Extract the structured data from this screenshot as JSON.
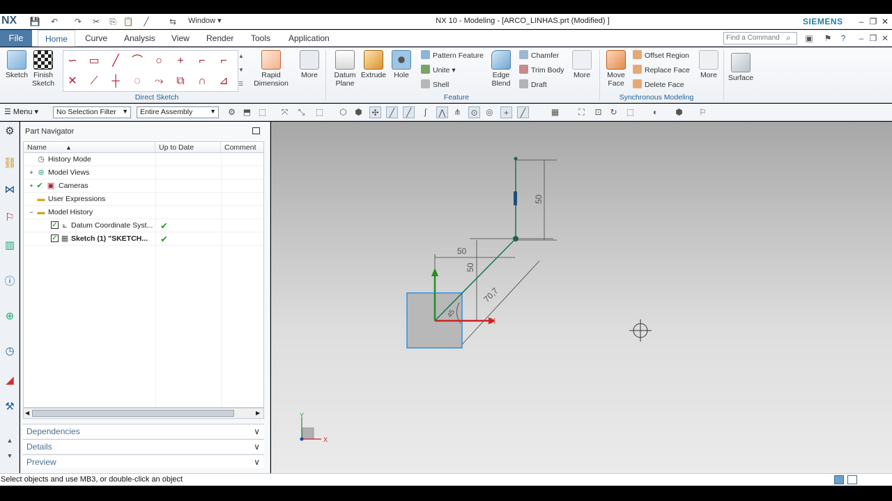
{
  "titlebar": {
    "logo": "NX",
    "window_menu": "Window ▾",
    "title": "NX 10 - Modeling - [ARCO_LINHAS.prt (Modified) ]",
    "brand": "SIEMENS"
  },
  "tabs": {
    "file": "File",
    "items": [
      "Home",
      "Curve",
      "Analysis",
      "View",
      "Render",
      "Tools",
      "Application"
    ],
    "active": "Home",
    "search_placeholder": "Find a Command"
  },
  "ribbon": {
    "sketch": "Sketch",
    "finish_sketch": "Finish Sketch",
    "direct_sketch_label": "Direct Sketch",
    "rapid_dimension": "Rapid Dimension",
    "more": "More",
    "datum_plane": "Datum Plane",
    "extrude": "Extrude",
    "hole": "Hole",
    "pattern_feature": "Pattern Feature",
    "unite": "Unite",
    "shell": "Shell",
    "edge_blend": "Edge Blend",
    "chamfer": "Chamfer",
    "trim_body": "Trim Body",
    "draft": "Draft",
    "feature_label": "Feature",
    "move_face": "Move Face",
    "offset_region": "Offset Region",
    "replace_face": "Replace Face",
    "delete_face": "Delete Face",
    "synchronous_label": "Synchronous Modeling",
    "surface": "Surface"
  },
  "selection_bar": {
    "menu": "Menu",
    "filter": "No Selection Filter",
    "scope": "Entire Assembly"
  },
  "navigator": {
    "title": "Part Navigator",
    "columns": [
      "Name",
      "Up to Date",
      "Comment"
    ],
    "rows": [
      {
        "label": "History Mode",
        "check": ""
      },
      {
        "label": "Model Views",
        "check": ""
      },
      {
        "label": "Cameras",
        "check": ""
      },
      {
        "label": "User Expressions",
        "check": ""
      },
      {
        "label": "Model History",
        "check": ""
      },
      {
        "label": "Datum Coordinate Syst...",
        "check": "✔"
      },
      {
        "label": "Sketch (1) \"SKETCH...",
        "check": "✔"
      }
    ],
    "panels": [
      "Dependencies",
      "Details",
      "Preview"
    ]
  },
  "graphics": {
    "dim_vertical_top": "50",
    "dim_horizontal": "50",
    "dim_vertical_low": "50",
    "dim_diagonal": "70,7",
    "dim_angle": "45",
    "axis_x": "X",
    "triad_x": "X",
    "triad_y": "Y"
  },
  "status": {
    "message": "Select objects and use MB3, or double-click an object"
  }
}
